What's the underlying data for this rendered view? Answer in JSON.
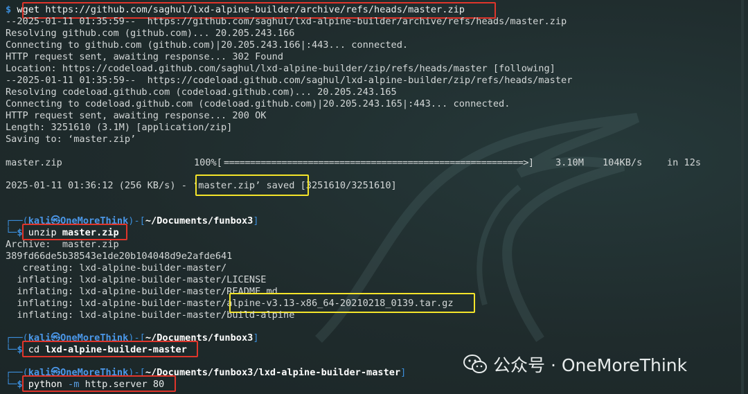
{
  "watermark": {
    "text": "公众号 · OneMoreThink"
  },
  "terminal": {
    "wget": {
      "prompt_symbol": "$",
      "cmd_name": "wget",
      "cmd_args": "https://github.com/saghul/lxd-alpine-builder/archive/refs/heads/master.zip"
    },
    "out": [
      "--2025-01-11 01:35:59--  https://github.com/saghul/lxd-alpine-builder/archive/refs/heads/master.zip",
      "Resolving github.com (github.com)... 20.205.243.166",
      "Connecting to github.com (github.com)|20.205.243.166|:443... connected.",
      "HTTP request sent, awaiting response... 302 Found",
      "Location: https://codeload.github.com/saghul/lxd-alpine-builder/zip/refs/heads/master [following]",
      "--2025-01-11 01:35:59--  https://codeload.github.com/saghul/lxd-alpine-builder/zip/refs/heads/master",
      "Resolving codeload.github.com (codeload.github.com)... 20.205.243.165",
      "Connecting to codeload.github.com (codeload.github.com)|20.205.243.165|:443... connected.",
      "HTTP request sent, awaiting response... 200 OK",
      "Length: 3251610 (3.1M) [application/zip]",
      "Saving to: ‘master.zip’"
    ],
    "progress": {
      "file": "master.zip",
      "percent": "100%[",
      "bar": "=========================================================>]",
      "size": "3.10M",
      "rate": "104KB/s",
      "time": "in 12s"
    },
    "saved": {
      "prefix": "2025-01-11 01:36:12 (256 KB/s) - ",
      "highlight": "‘master.zip’ saved",
      "suffix": " [3251610/3251610]"
    },
    "prompt1": {
      "user": "kali㉿OneMoreThink",
      "path": "~/Documents/funbox3"
    },
    "unzip": {
      "cmd_name": "unzip",
      "cmd_args": "master.zip"
    },
    "unzip_out": [
      "Archive:  master.zip",
      "389fd66de5b38543e1de20b104048d9e2afde641",
      "   creating: lxd-alpine-builder-master/",
      "  inflating: lxd-alpine-builder-master/LICENSE",
      "  inflating: lxd-alpine-builder-master/README.md"
    ],
    "inflate_alpine": {
      "prefix": "  inflating: lxd-alpine-builder-master/",
      "highlight": "alpine-v3.13-x86_64-20210218_0139.tar.gz"
    },
    "inflate_build": "  inflating: lxd-alpine-builder-master/build-alpine",
    "prompt2": {
      "user": "kali㉿OneMoreThink",
      "path": "~/Documents/funbox3"
    },
    "cd": {
      "cmd_name": "cd",
      "cmd_args": "lxd-alpine-builder-master"
    },
    "prompt3": {
      "user": "kali㉿OneMoreThink",
      "path": "~/Documents/funbox3/lxd-alpine-builder-master"
    },
    "python": {
      "cmd_name": "python",
      "flag": "-m",
      "cmd_args": "http.server 80"
    }
  },
  "colors": {
    "background": "#1f2b2c",
    "red_box": "#e0352b",
    "yellow_box": "#f5e52a",
    "prompt_blue": "#3b8edb"
  }
}
